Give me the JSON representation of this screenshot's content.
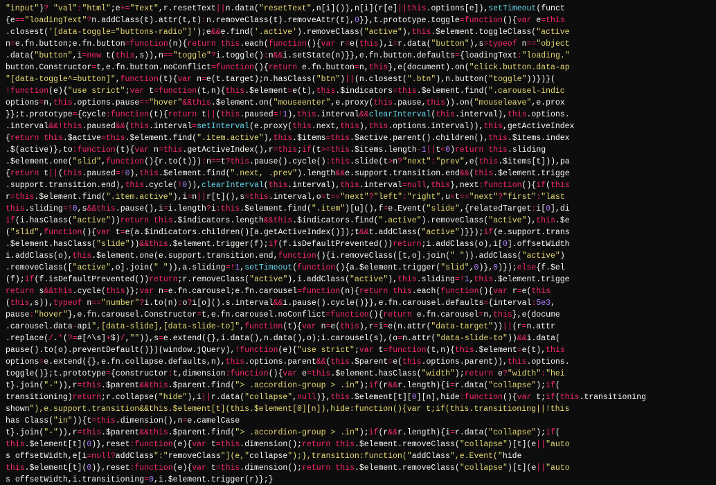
{
  "editor": {
    "background": "#0d0d0d",
    "lines": [
      "\"input\")? \"val\":\"html\";e+=\"Text\",r.resetText||n.data(\"resetText\",n[i]()),n[i](r[e]||this.options[e]),setTimeout(funct",
      "{e==\"loadingText\"?n.addClass(t).attr(t,t):n.removeClass(t).removeAttr(t),0}},t.prototype.toggle=function(){var e=this",
      ".closest('[data-toggle=\"buttons-radio\"]');e&&e.find('.active').removeClass(\"active\"),this.$element.toggleClass(\"active",
      "n=e.fn.button;e.fn.button=function(n){return this.each(function(){var r=e(this),i=r.data(\"button\"),s=typeof n==\"object",
      ".data(\"button\",i=new t(this,s)),n==\"toggle\"?i.toggle():n&&i.setState(n)}},e.fn.button.defaults={loadingText:\"loading.\"",
      "button.Constructor=t,e.fn.button.noConflict=function(){return e.fn.button=n,this},e(document).on(\"click.button.data-ap",
      "\"[data-toggle^=button]\",function(t){var n=e(t.target);n.hasClass(\"btn\")||(n.closest(\".btn\"),n.button(\"toggle\"))})}(",
      "!function(e){\"use strict\";var t=function(t,n){this.$element=e(t),this.$indicators=this.$element.find(\".carousel-indic",
      "options=n,this.options.pause==\"hover\"&&this.$element.on(\"mouseenter\",e.proxy(this.pause,this)).on(\"mouseleave\",e.prox",
      "}};t.prototype={cycle:function(t){return t||(this.paused=!1),this.interval&&clearInterval(this.interval),this.options.",
      ".interval&&!this.paused&&(this.interval=setInterval(e.proxy(this.next,this),this.options.interval)),this,getActiveIndex",
      "{return this.$active=this.$element.find(\".item.active\"),this.$items=this.$active.parent().children(),this.$items.index",
      ".$(active)},to:function(t){var n=this.getActiveIndex(),r=this;if(t>=this.$items.length-1||t<0)return this.sliding",
      ".$element.one(\"slid\",function(){r.to(t)}):n==t?this.pause().cycle():this.slide(t>n?\"next\":\"prev\",e(this.$items[t])),pa",
      "{return t||(this.paused=!0),this.$element.find(\".next, .prev\").length&&e.support.transition.end&&(this.$element.trigge",
      ".support.transition.end),this.cycle(!0)),clearInterval(this.interval),this.interval=null,this},next:function(){if(this",
      "r=this.$element.find(\".item.active\"),i=n||r[t](),s=this.interval,o=t==\"next\"?\"left\":\"right\",u=t==\"next\"?\"first\":\"last",
      "this.sliding=!0,s&&this.pause(),i=i.length?i:this.$element.find(\".item\")[u](),f=e.Event(\"slide\",{relatedTarget:i[0],di",
      "if(i.hasClass(\"active\"))return this.$indicators.length&&this.$indicators.find(\".active\").removeClass(\"active\"),this.$e",
      "(\"slid\",function(){var t=e(a.$indicators.children()[a.getActiveIndex()]);t&&t.addClass(\"active\")}});if(e.support.trans",
      ".$element.hasClass(\"slide\"))&&this.$element.trigger(f);if(f.isDefaultPrevented())return;i.addClass(o),i[0].offsetWidth",
      "i.addClass(o),this.$element.one(e.support.transition.end,function(){i.removeClass([t,o].join(\" \")).addClass(\"active\")",
      ".removeClass([\"active\",o].join(\" \")),a.sliding=!1,setTimeout(function(){a.$element.trigger(\"slid\",0)},0)});else{f.$el",
      "(f);if(f.isDefaultPrevented())return;r.removeClass(\"active\"),i.addClass(\"active\"),this.sliding=!1,this.$element.trigge",
      "return s&&this.cycle(this)};var n=e.fn.carousel;e.fn.carousel=function(n){return this.each(function(){var r=e(this",
      "(this,s)),typeof n==\"number\"?i.to(n):o?i[o]().s.interval&&i.pause().cycle()}},e.fn.carousel.defaults={interval:5e3,",
      "pause:\"hover\"},e.fn.carousel.Constructor=t,e.fn.carousel.noConflict=function(){return e.fn.carousel=n,this},e(docume",
      ".carousel.data-api\",[data-slide],[data-slide-to]\",function(t){var n=e(this),r=i=e(n.attr(\"data-target\"))||(r=n.attr",
      ".replace(/.*(?=#[^\\s]+$)/,\"\")),s=e.extend({},i.data(),n.data(),o);i.carousel(s),(o=n.attr(\"data-slide-to\"))&&i.data(",
      "pause().to(o).preventDefault()})(window.jQuery),!function(e){\"use strict\";var t=function(t,n){this.$element=e(t),this",
      "options=e.extend({},e.fn.collapse.defaults,n),this.options.parent&&(this.$parent=e(this.options.parent)),this.options.",
      "toggle()};t.prototype={constructor:t,dimension:function(){var e=this.$element.hasClass(\"width\");return e?\"width\":\"hei",
      "t}.join(\"-\")),r=this.$parent&&this.$parent.find(\"> .accordion-group > .in\");if(r&&r.length){i=r.data(\"collapse\");if(",
      "transitioning)return;r.collapse(\"hide\"),i||r.data(\"collapse\",null)},this.$element[t][0][n],hide:function(){var t;if(this.transitioning",
      "shown\"),e.support.transition&&this.$element[t](this.$element[0][n]),hide:function(){var t;if(this.transitioning||!this",
      "has Class(\"in\")){t=this.dimension(),n=e.camelCase",
      "t}.join(\"-\")),r=this.$parent&&this.$parent.find(\"> .accordion-group > .in\");if(r&&r.length){i=r.data(\"collapse\");if(",
      "this.$element[t](0)},reset:function(e){var t=this.dimension();return this.$element.removeClass(\"collapse\")[t](e||\"auto",
      "s offsetWidth,e[i=null?addClass\":\"removeClass\"](e,\"collapse\");},transition:function(\"addClass\",e.Event(\"hide",
      "this.$element[t](0)},reset:function(e){var t=this.dimension();return this.$element.removeClass(\"collapse\")[t](e||\"auto",
      "s offsetWidth,i.transitioning=0,i.$element.trigger(r)};}"
    ]
  }
}
